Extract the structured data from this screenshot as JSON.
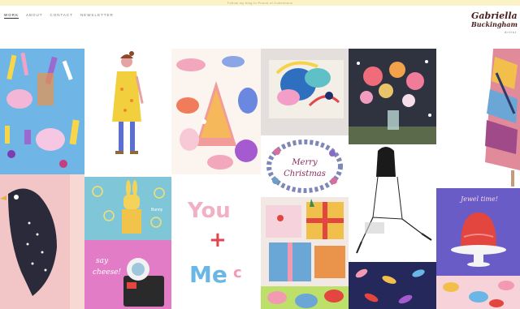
{
  "banner": "Follow my blog to Pound of Collections",
  "nav": [
    "Work",
    "About",
    "Contact",
    "Newsletter"
  ],
  "logo": {
    "line1": "Gabriella",
    "line2": "Buckingham",
    "line3": "Artist"
  },
  "tiles": {
    "fashion": "fashion dress illustration",
    "merry_christmas": "Merry Christmas",
    "say_cheese": "say cheese!",
    "you_me": [
      "You",
      "+",
      "Me"
    ],
    "jelly": "Jewel time!",
    "bunny_label": "Bunny"
  },
  "colors": {
    "banner_bg": "#fbf3c6",
    "logo": "#4a1e1e"
  }
}
